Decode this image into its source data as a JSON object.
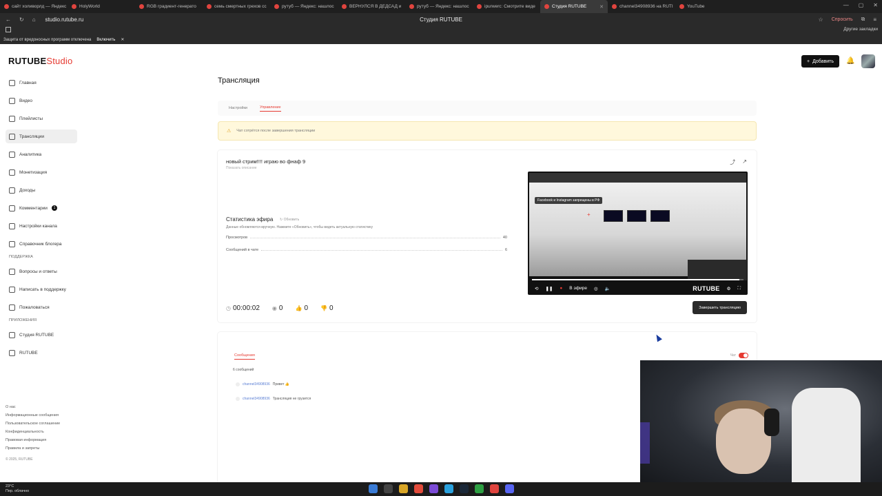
{
  "browser": {
    "tabs": [
      {
        "label": "сайт холиворлд — Яндекс"
      },
      {
        "label": "HolyWorld"
      },
      {
        "label": "RGB градиент-генерато"
      },
      {
        "label": "семь смертных грехов сс"
      },
      {
        "label": "рутуб — Яндекс: нашлос"
      },
      {
        "label": "ВЕРНУЛСЯ В ДЕДСАД и"
      },
      {
        "label": "рутуб — Яндекс: нашлос"
      },
      {
        "label": "ipurwerc: Смотрите виде"
      },
      {
        "label": "Студия RUTUBE",
        "active": true
      },
      {
        "label": "channel34908936 на RUTI"
      },
      {
        "label": "YouTube"
      }
    ],
    "url": "studio.rutube.ru",
    "page_title": "Студия RUTUBE",
    "ask_label": "Спросить",
    "other_bookmarks": "Другие закладки",
    "infobar_text": "Защита от вредоносных программ отключена",
    "infobar_enable": "Включить"
  },
  "header": {
    "logo_main": "RUTUBE",
    "logo_studio": "Studio",
    "add_label": "Добавить"
  },
  "sidebar": {
    "items": [
      {
        "label": "Главная"
      },
      {
        "label": "Видео"
      },
      {
        "label": "Плейлисты"
      },
      {
        "label": "Трансляции",
        "active": true
      },
      {
        "label": "Аналитика"
      },
      {
        "label": "Монетизация"
      },
      {
        "label": "Доходы"
      },
      {
        "label": "Комментарии",
        "badge": "1"
      },
      {
        "label": "Настройки канала"
      },
      {
        "label": "Справочник блогера"
      }
    ],
    "support_title": "ПОДДЕРЖКА",
    "support_items": [
      {
        "label": "Вопросы и ответы"
      },
      {
        "label": "Написать в поддержку"
      },
      {
        "label": "Пожаловаться"
      }
    ],
    "apps_title": "ПРИЛОЖЕНИЯ",
    "apps_items": [
      {
        "label": "Студия RUTUBE"
      },
      {
        "label": "RUTUBE"
      }
    ],
    "footer_links": [
      "О нас",
      "Информационные сообщения",
      "Пользовательское соглашение",
      "Конфиденциальность",
      "Правовая информация",
      "Правила и запреты"
    ],
    "copyright": "© 2025, RUTUBE"
  },
  "main": {
    "title": "Трансляция",
    "tabs": [
      {
        "label": "Настройки"
      },
      {
        "label": "Управление",
        "active": true
      }
    ],
    "warning": "Чат сотрётся после завершения трансляции",
    "stream": {
      "title": "новый стрим!!!! играю во фнаф 9",
      "subtitle": "Показать описание",
      "stats_title": "Статистика эфира",
      "stats_refresh": "Обновить",
      "stats_desc": "Данные обновляются вручную. Нажмите «Обновить», чтобы видеть актуальную статистику",
      "views_label": "Просмотров",
      "views_value": "40",
      "messages_label": "Сообщений в чате",
      "messages_value": "6",
      "timer": "00:00:02",
      "viewers": "0",
      "likes": "0",
      "dislikes": "0",
      "finish_label": "Завершить трансляцию"
    },
    "player": {
      "banner": "Facebook и Instagram запрещены в РФ",
      "live_label": "В эфире",
      "brand": "RUTUBE",
      "progress": 0.98
    },
    "chat": {
      "tab_label": "Сообщения",
      "count": "6 сообщений",
      "toggle_label": "Чат",
      "messages": [
        {
          "user": "channel34908936",
          "text": "Привет 👍"
        },
        {
          "user": "channel34908936",
          "text": "Трансляция не грузится"
        }
      ]
    }
  },
  "taskbar": {
    "weather_temp": "23°C",
    "weather_desc": "Пер. облачно"
  }
}
